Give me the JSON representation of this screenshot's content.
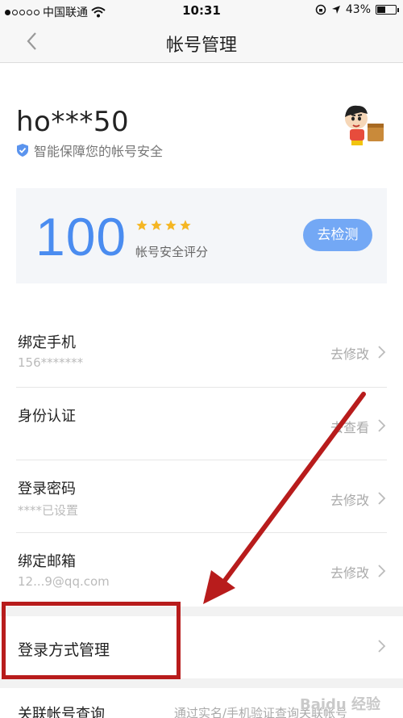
{
  "status_bar": {
    "carrier": "中国联通",
    "time": "10:31",
    "battery": "43%"
  },
  "nav": {
    "title": "帐号管理",
    "back_icon": "chevron-left-icon"
  },
  "profile": {
    "username": "ho***50",
    "security_note": "智能保障您的帐号安全",
    "shield_icon": "shield-check-icon",
    "avatar_icon": "cartoon-avatar"
  },
  "score_card": {
    "score": "100",
    "star_count": 4,
    "label": "帐号安全评分",
    "button_label": "去检测"
  },
  "items": [
    {
      "label": "绑定手机",
      "sub": "156*******",
      "action": "去修改"
    },
    {
      "label": "身份认证",
      "sub": "",
      "action": "去查看"
    },
    {
      "label": "登录密码",
      "sub": "****已设置",
      "action": "去修改"
    },
    {
      "label": "绑定邮箱",
      "sub": "12...9@qq.com",
      "action": "去修改"
    }
  ],
  "login_manage": {
    "label": "登录方式管理"
  },
  "linked_account": {
    "label": "关联帐号查询",
    "sub": "通过实名/手机验证查询关联帐号"
  },
  "colors": {
    "accent": "#4a8cf0",
    "button": "#73a8f5",
    "star": "#f5b623",
    "annotation": "#b81c1c"
  }
}
